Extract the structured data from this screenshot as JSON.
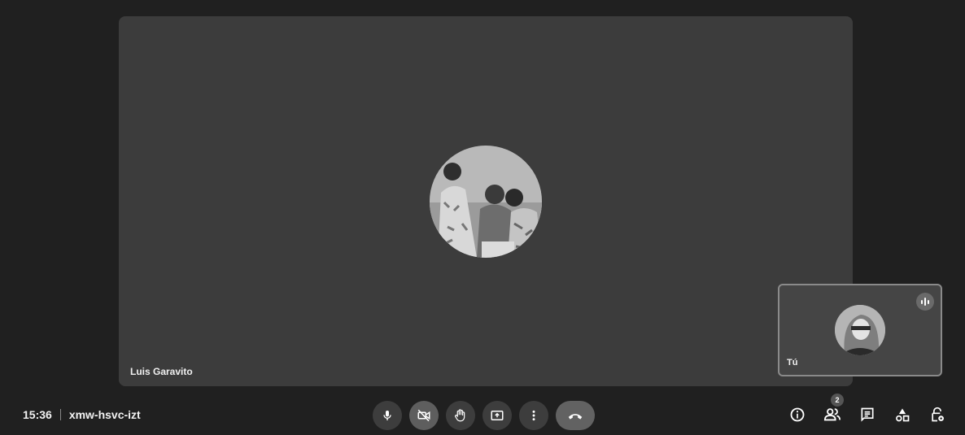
{
  "meeting": {
    "time": "15:36",
    "code": "xmw-hsvc-izt"
  },
  "main_participant": {
    "name": "Luis Garavito",
    "avatar_icon": "profile-photo"
  },
  "self_view": {
    "name": "Tú",
    "avatar_icon": "profile-photo",
    "audio_indicator_icon": "audio-level-icon"
  },
  "controls": {
    "microphone_icon": "microphone-icon",
    "camera_icon": "camera-off-icon",
    "raise_hand_icon": "hand-icon",
    "present_icon": "present-screen-icon",
    "more_icon": "more-vert-icon",
    "hangup_icon": "phone-hangup-icon"
  },
  "side_actions": {
    "participants_count": "2",
    "icons": [
      "info-icon",
      "people-icon",
      "chat-icon",
      "activities-icon",
      "host-controls-icon"
    ]
  },
  "colors": {
    "background": "#202020",
    "tile": "#3c3c3c",
    "hangup": "#626262"
  }
}
